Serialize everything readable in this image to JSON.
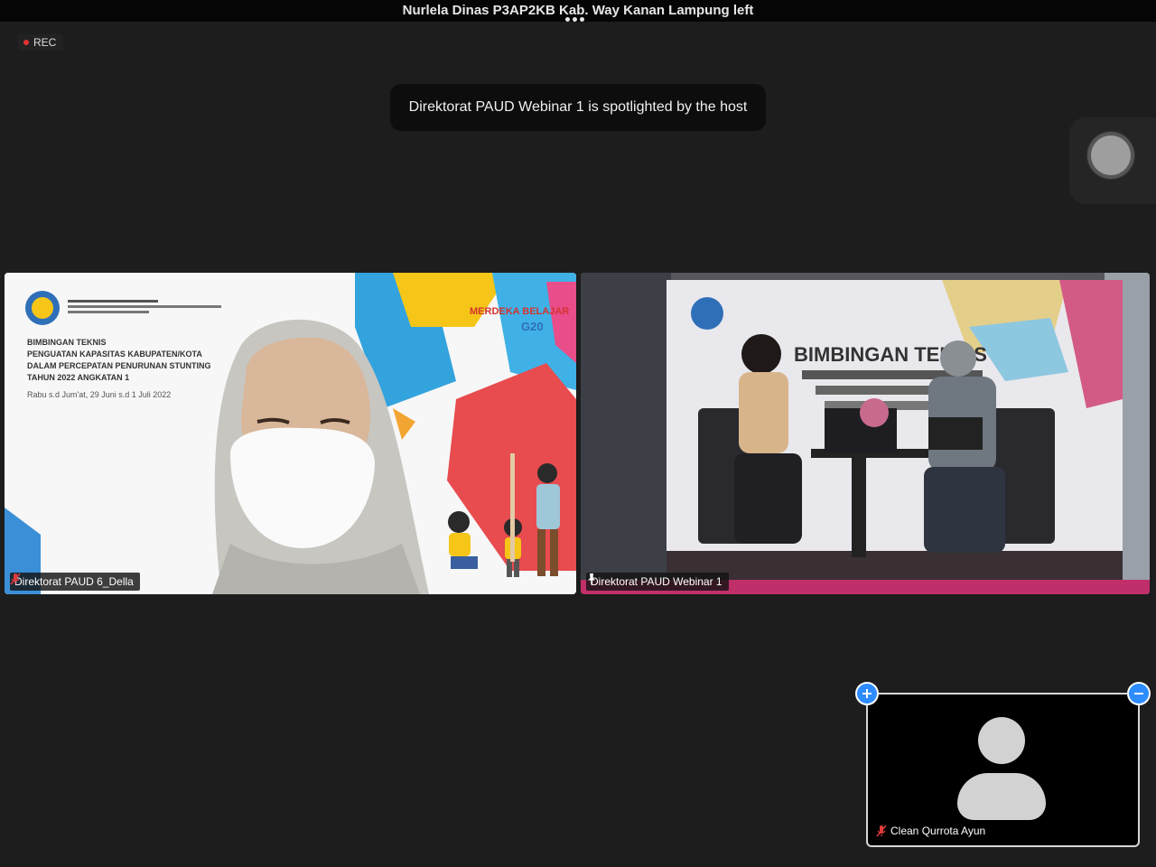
{
  "top_notification": "Nurlela Dinas P3AP2KB Kab. Way Kanan Lampung left",
  "recording": {
    "label": "REC"
  },
  "toast": "Direktorat PAUD Webinar 1 is spotlighted by the host",
  "tiles": [
    {
      "name": "Direktorat PAUD 6_Della",
      "muted": true,
      "slide": {
        "header": "DIREKTORAT PAUD",
        "title_lines": [
          "BIMBINGAN TEKNIS",
          "PENGUATAN KAPASITAS KABUPATEN/KOTA",
          "DALAM PERCEPATAN PENURUNAN STUNTING",
          "TAHUN 2022 ANGKATAN 1"
        ],
        "date": "Rabu s.d Jum'at, 29 Juni s.d 1 Juli 2022",
        "logos": [
          "MERDEKA BELAJAR",
          "G20"
        ]
      }
    },
    {
      "name": "Direktorat PAUD Webinar 1",
      "pinned": true,
      "active_speaker": true,
      "banner": "BIMBINGAN TEKNIS"
    }
  ],
  "self_view": {
    "name": "Clean Qurrota Ayun",
    "muted": true
  },
  "colors": {
    "accent": "#2d8cff",
    "active_border": "#38c94b",
    "background": "#1d1d1d"
  }
}
